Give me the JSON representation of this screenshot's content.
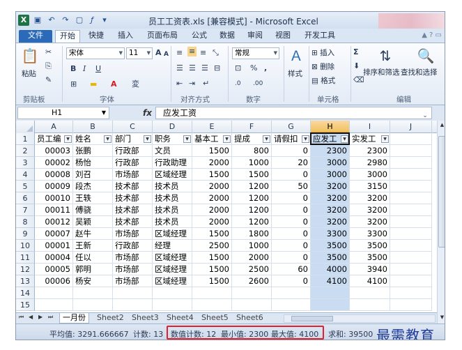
{
  "window": {
    "title": "员工工资表.xls  [兼容模式] - Microsoft Excel",
    "app_icon": "X"
  },
  "ribbon_tabs": [
    "文件",
    "开始",
    "快捷",
    "插入",
    "页面布局",
    "公式",
    "数据",
    "审阅",
    "视图",
    "开发工具"
  ],
  "ribbon": {
    "font_name": "宋体",
    "font_size": "11",
    "number_format": "常规",
    "paste": "粘贴",
    "style": "样式",
    "insert": "插入",
    "delete": "删除",
    "format": "格式",
    "sort_filter": "排序和筛选",
    "find_select": "查找和选择",
    "groups": [
      "剪贴板",
      "字体",
      "对齐方式",
      "数字",
      "单元格",
      "编辑"
    ],
    "bold": "B",
    "italic": "I",
    "underline": "U",
    "grow": "A",
    "shrink": "A",
    "currency": "%",
    "comma": ","
  },
  "formula_bar": {
    "name_box": "H1",
    "fx": "fx",
    "content": "应发工资"
  },
  "columns": [
    "A",
    "B",
    "C",
    "D",
    "E",
    "F",
    "G",
    "H",
    "I",
    "J"
  ],
  "selected_column": "H",
  "rows": [
    "1",
    "2",
    "3",
    "4",
    "5",
    "6",
    "7",
    "8",
    "9",
    "10",
    "11",
    "12",
    "13",
    "14",
    "15"
  ],
  "headers": [
    "员工编",
    "姓名",
    "部门",
    "职务",
    "基本工",
    "提成",
    "请假扣",
    "应发工",
    "实发工"
  ],
  "table": [
    [
      "00003",
      "张鹏",
      "行政部",
      "文员",
      "1500",
      "800",
      "0",
      "2300",
      "2300"
    ],
    [
      "00002",
      "杨怡",
      "行政部",
      "行政助理",
      "2000",
      "1000",
      "20",
      "3000",
      "2980"
    ],
    [
      "00008",
      "刘召",
      "市场部",
      "区域经理",
      "1500",
      "1500",
      "0",
      "3000",
      "3000"
    ],
    [
      "00009",
      "段杰",
      "技术部",
      "技术员",
      "2000",
      "1200",
      "50",
      "3200",
      "3150"
    ],
    [
      "00010",
      "王轶",
      "技术部",
      "技术员",
      "2000",
      "1200",
      "0",
      "3200",
      "3200"
    ],
    [
      "00011",
      "傅骁",
      "技术部",
      "技术员",
      "2000",
      "1200",
      "0",
      "3200",
      "3200"
    ],
    [
      "00012",
      "吴颖",
      "技术部",
      "技术员",
      "2000",
      "1200",
      "0",
      "3200",
      "3200"
    ],
    [
      "00007",
      "赵牛",
      "市场部",
      "区域经理",
      "1500",
      "1800",
      "0",
      "3300",
      "3300"
    ],
    [
      "00001",
      "王新",
      "行政部",
      "经理",
      "2500",
      "1000",
      "0",
      "3500",
      "3500"
    ],
    [
      "00004",
      "任以",
      "市场部",
      "区域经理",
      "1500",
      "2000",
      "0",
      "3500",
      "3500"
    ],
    [
      "00005",
      "郭明",
      "市场部",
      "区域经理",
      "1500",
      "2500",
      "60",
      "4000",
      "3940"
    ],
    [
      "00006",
      "杨安",
      "市场部",
      "区域经理",
      "1500",
      "2600",
      "0",
      "4100",
      "4100"
    ]
  ],
  "sheet_tabs": [
    "一月份",
    "Sheet2",
    "Sheet3",
    "Sheet4",
    "Sheet5",
    "Sheet6"
  ],
  "status": {
    "average": "平均值: 3291.666667",
    "count": "计数: 13",
    "numeric_count": "数值计数: 12",
    "min": "最小值: 2300",
    "max": "最大值: 4100",
    "sum": "求和: 39500"
  },
  "brand": "最需教育",
  "colors": {
    "file_tab": "#2a6ab8",
    "selection": "#c9dcf1",
    "highlight_box": "#e0212d",
    "brand": "#1e3a9a"
  }
}
